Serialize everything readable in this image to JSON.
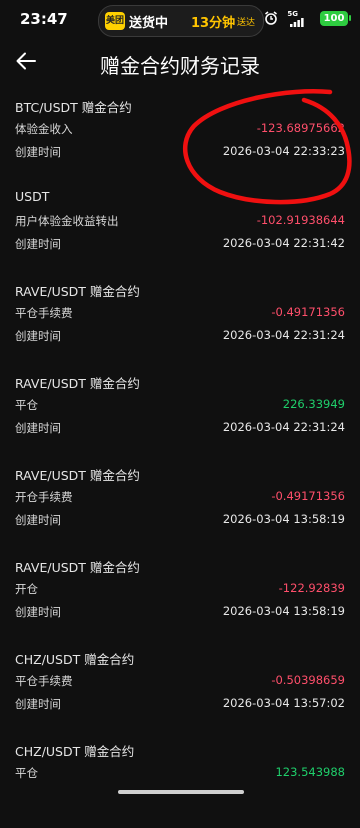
{
  "status_bar": {
    "time": "23:47",
    "meituan_logo": "美团",
    "delivery_text": "送货中",
    "minutes": "13分钟",
    "minutes_suffix": "送达",
    "network": "5G",
    "battery": "100"
  },
  "header": {
    "back_icon": "arrow-left-icon",
    "title": "赠金合约财务记录"
  },
  "records": [
    {
      "name": "BTC/USDT 赠金合约",
      "type": "体验金收入",
      "amount": "-123.68975662",
      "amount_color": "#ff4f6b",
      "time_label": "创建时间",
      "time": "2026-03-04 22:33:23"
    },
    {
      "name": "USDT",
      "type": "用户体验金收益转出",
      "amount": "-102.91938644",
      "amount_color": "#ff4f6b",
      "time_label": "创建时间",
      "time": "2026-03-04 22:31:42"
    },
    {
      "name": "RAVE/USDT 赠金合约",
      "type": "平仓手续费",
      "amount": "-0.49171356",
      "amount_color": "#ff4f6b",
      "time_label": "创建时间",
      "time": "2026-03-04 22:31:24"
    },
    {
      "name": "RAVE/USDT 赠金合约",
      "type": "平仓",
      "amount": "226.33949",
      "amount_color": "#1fcf6b",
      "time_label": "创建时间",
      "time": "2026-03-04 22:31:24"
    },
    {
      "name": "RAVE/USDT 赠金合约",
      "type": "开仓手续费",
      "amount": "-0.49171356",
      "amount_color": "#ff4f6b",
      "time_label": "创建时间",
      "time": "2026-03-04 13:58:19"
    },
    {
      "name": "RAVE/USDT 赠金合约",
      "type": "开仓",
      "amount": "-122.92839",
      "amount_color": "#ff4f6b",
      "time_label": "创建时间",
      "time": "2026-03-04 13:58:19"
    },
    {
      "name": "CHZ/USDT 赠金合约",
      "type": "平仓手续费",
      "amount": "-0.50398659",
      "amount_color": "#ff4f6b",
      "time_label": "创建时间",
      "time": "2026-03-04 13:57:02"
    },
    {
      "name": "CHZ/USDT 赠金合约",
      "type": "平仓",
      "amount": "123.543988",
      "amount_color": "#1fcf6b",
      "time_label": "",
      "time": ""
    }
  ]
}
